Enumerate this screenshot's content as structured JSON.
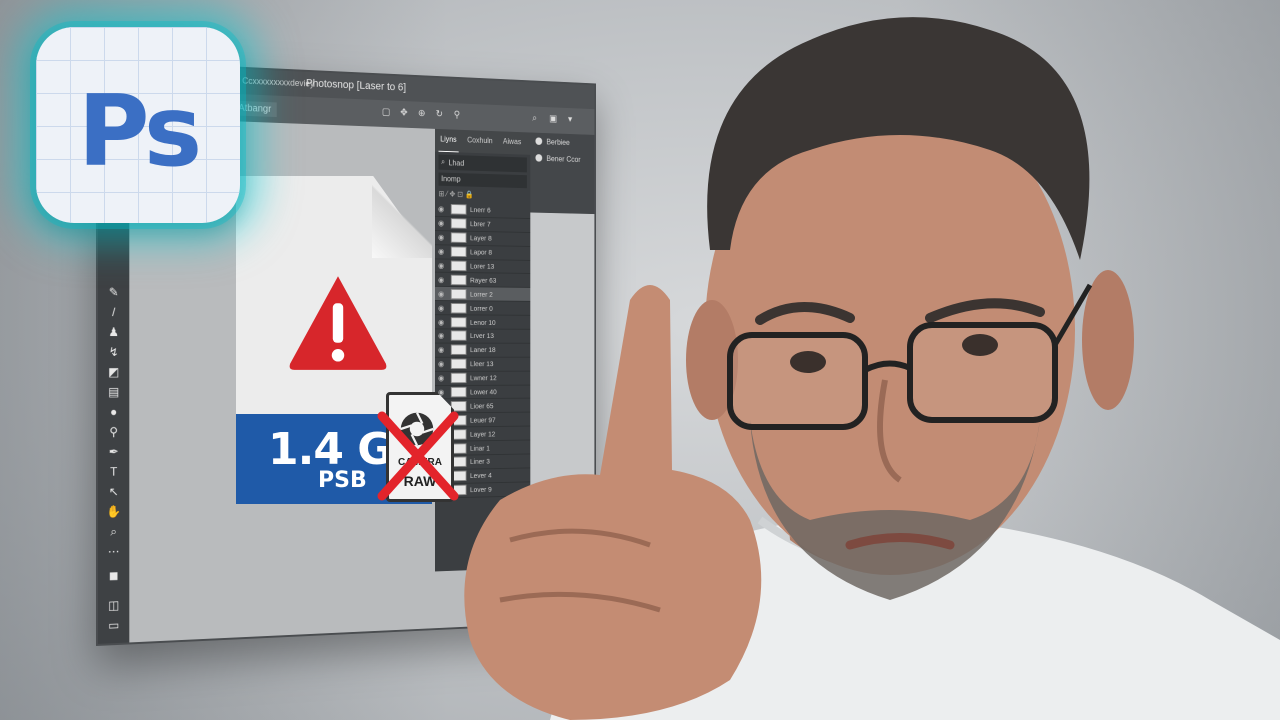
{
  "app": {
    "window_title": "Photosnop [Laser to 6]",
    "document_label": "Ccxxxxxxxxxdeviey",
    "doc_tab": "Atbangr"
  },
  "app_icon": {
    "label": "Ps",
    "brand_color": "#3b6fc4",
    "glow_color": "#00c8d2"
  },
  "panels": {
    "tabs": [
      "Liyns",
      "Coxhuln",
      "Aiwas"
    ],
    "filter_label": "Lhad",
    "blend_label": "Inomp",
    "right_items": [
      "Berbiee",
      "Bener Ccor"
    ]
  },
  "layers": [
    "Lnerr 6",
    "Lbrer 7",
    "Layer 8",
    "Lapor 8",
    "Lorer 13",
    "Rayer 63",
    "Lorrer 2",
    "Lorrer 0",
    "Lenor 10",
    "Lrver 13",
    "Laner 18",
    "Lleer 13",
    "Lwner 12",
    "Lower 40",
    "Lioer 65",
    "Leuer 97",
    "Layer 12",
    "Linar 1",
    "Liner 3",
    "Lever 4",
    "Lover 9"
  ],
  "selected_layer_index": 6,
  "file_card": {
    "size": "1.4 GB",
    "type": "PSB",
    "warning_color": "#d7262b",
    "band_color": "#1f5aa8"
  },
  "raw_badge": {
    "line1": "CAMERA",
    "line2": "RAW"
  }
}
